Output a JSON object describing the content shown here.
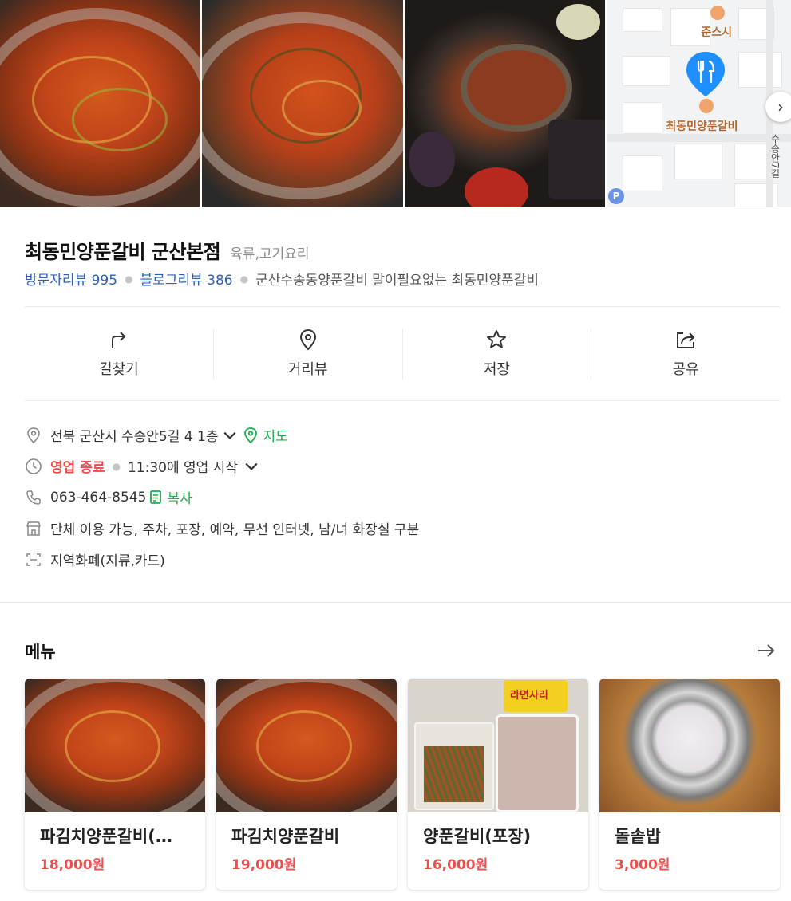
{
  "photos": [
    {
      "icon": "food-photo-1"
    },
    {
      "icon": "food-photo-2"
    },
    {
      "icon": "food-photo-3"
    }
  ],
  "map": {
    "poi_label": "준스시",
    "pin_label": "최동민양푼갈비",
    "street_label": "수송안7길",
    "parking_label": "P"
  },
  "place": {
    "name": "최동민양푼갈비 군산본점",
    "category": "육류,고기요리",
    "visitor_review": "방문자리뷰 995",
    "blog_review": "블로그리뷰 386",
    "tagline": "군산수송동양푼갈비 말이필요없는 최동민양푼갈비"
  },
  "actions": [
    {
      "label": "길찾기",
      "icon": "directions-icon"
    },
    {
      "label": "거리뷰",
      "icon": "street-view-icon"
    },
    {
      "label": "저장",
      "icon": "star-icon"
    },
    {
      "label": "공유",
      "icon": "share-icon"
    }
  ],
  "info": {
    "address": "전북 군산시 수송안5길 4 1층",
    "map_link": "지도",
    "status": "영업 종료",
    "hours": "11:30에 영업 시작",
    "phone": "063-464-8545",
    "copy": "복사",
    "amenities": "단체 이용 가능, 주차, 포장, 예약, 무선 인터넷, 남/녀 화장실 구분",
    "payment": "지역화폐(지류,카드)"
  },
  "menu": {
    "title": "메뉴",
    "items": [
      {
        "name": "파김치양푼갈비(…",
        "price": "18,000원"
      },
      {
        "name": "파김치양푼갈비",
        "price": "19,000원"
      },
      {
        "name": "양푼갈비(포장)",
        "price": "16,000원"
      },
      {
        "name": "돌솥밥",
        "price": "3,000원"
      }
    ],
    "pack_label": "라면사리"
  },
  "colors": {
    "link_blue": "#2b5fb9",
    "closed_red": "#ed4c4c",
    "green": "#1cae4c",
    "price_red": "#ef4e4e",
    "pin_blue": "#1f8fff"
  }
}
